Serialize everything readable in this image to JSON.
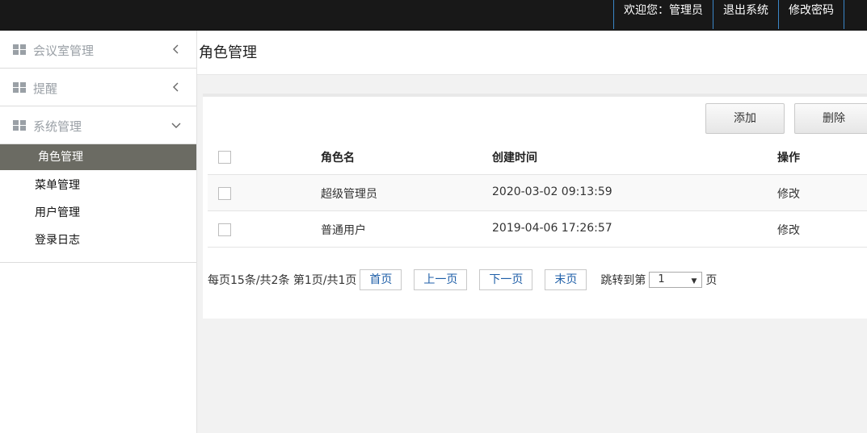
{
  "topbar": {
    "welcome": "欢迎您：管理员",
    "logout": "退出系统",
    "change_password": "修改密码"
  },
  "sidebar": {
    "groups": [
      {
        "label": "会议室管理",
        "state": "collapsed"
      },
      {
        "label": "提醒",
        "state": "collapsed"
      },
      {
        "label": "系统管理",
        "state": "expanded"
      }
    ],
    "sub_items": [
      {
        "label": "角色管理",
        "active": true
      },
      {
        "label": "菜单管理"
      },
      {
        "label": "用户管理"
      },
      {
        "label": "登录日志"
      }
    ]
  },
  "page": {
    "title": "角色管理"
  },
  "toolbar": {
    "add_label": "添加",
    "delete_label": "删除"
  },
  "table": {
    "columns": [
      "角色名",
      "创建时间",
      "操作"
    ],
    "rows": [
      {
        "name": "超级管理员",
        "created": "2020-03-02 09:13:59",
        "action": "修改"
      },
      {
        "name": "普通用户",
        "created": "2019-04-06 17:26:57",
        "action": "修改"
      }
    ]
  },
  "pager": {
    "info": "每页15条/共2条 第1页/共1页",
    "first": "首页",
    "prev": "上一页",
    "next": "下一页",
    "last": "末页",
    "jump_prefix": "跳转到第",
    "jump_value": "1",
    "jump_suffix": "页"
  },
  "colors": {
    "topbar_bg": "#181818",
    "nav_divider": "#3a86c8",
    "active_menu_bg": "#6b6b63",
    "pager_link": "#1f5fa8"
  }
}
